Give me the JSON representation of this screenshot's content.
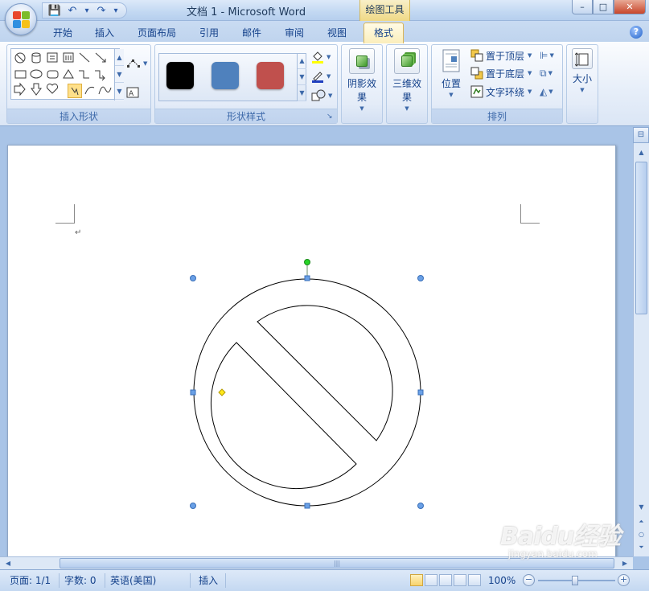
{
  "window": {
    "title": "文档 1 - Microsoft Word",
    "context_tab_header": "绘图工具",
    "controls": {
      "minimize": "–",
      "maximize": "□",
      "close": "✕"
    }
  },
  "quick_access": {
    "save": "💾",
    "undo": "↶",
    "redo": "↷",
    "more": "▾"
  },
  "tabs": [
    {
      "label": "开始"
    },
    {
      "label": "插入"
    },
    {
      "label": "页面布局"
    },
    {
      "label": "引用"
    },
    {
      "label": "邮件"
    },
    {
      "label": "审阅"
    },
    {
      "label": "视图"
    },
    {
      "label": "格式",
      "active": true
    }
  ],
  "help": "?",
  "ribbon": {
    "groups": {
      "insert_shapes": {
        "label": "插入形状"
      },
      "shape_styles": {
        "label": "形状样式",
        "launcher": "↘"
      },
      "shadow": {
        "label": "阴影效果"
      },
      "threed": {
        "label": "三维效果"
      },
      "arrange": {
        "label": "排列",
        "position": "位置",
        "bring_front": "置于顶层",
        "send_back": "置于底层",
        "text_wrap": "文字环绕"
      },
      "size": {
        "label": "大小"
      }
    },
    "swatch_colors": [
      "#000000",
      "#4f81bd",
      "#c0504d"
    ]
  },
  "document": {
    "paragraph_mark": "↵"
  },
  "statusbar": {
    "page": "页面: 1/1",
    "words": "字数: 0",
    "language": "英语(美国)",
    "mode": "插入",
    "zoom": "100%",
    "zoom_minus": "−",
    "zoom_plus": "+"
  },
  "watermark": {
    "logo": "Baidu经验",
    "url": "jingyan.baidu.com"
  }
}
